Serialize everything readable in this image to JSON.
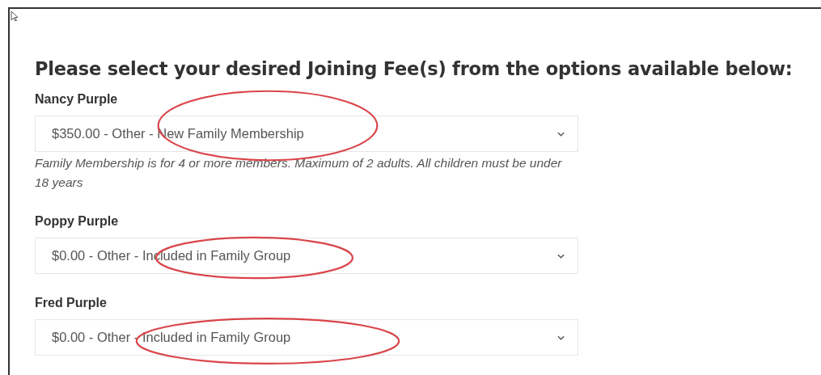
{
  "heading": "Please select your desired Joining Fee(s) from the options available below:",
  "members": [
    {
      "name": "Nancy Purple",
      "value": "$350.00 - Other - New Family Membership",
      "note": "Family Membership is for 4 or more members. Maximum of 2 adults. All children must be under 18 years",
      "circled": true
    },
    {
      "name": "Poppy Purple",
      "value": "$0.00 - Other - Included in Family Group",
      "circled": true
    },
    {
      "name": "Fred Purple",
      "value": "$0.00 - Other - Included in Family Group",
      "circled": true
    }
  ]
}
